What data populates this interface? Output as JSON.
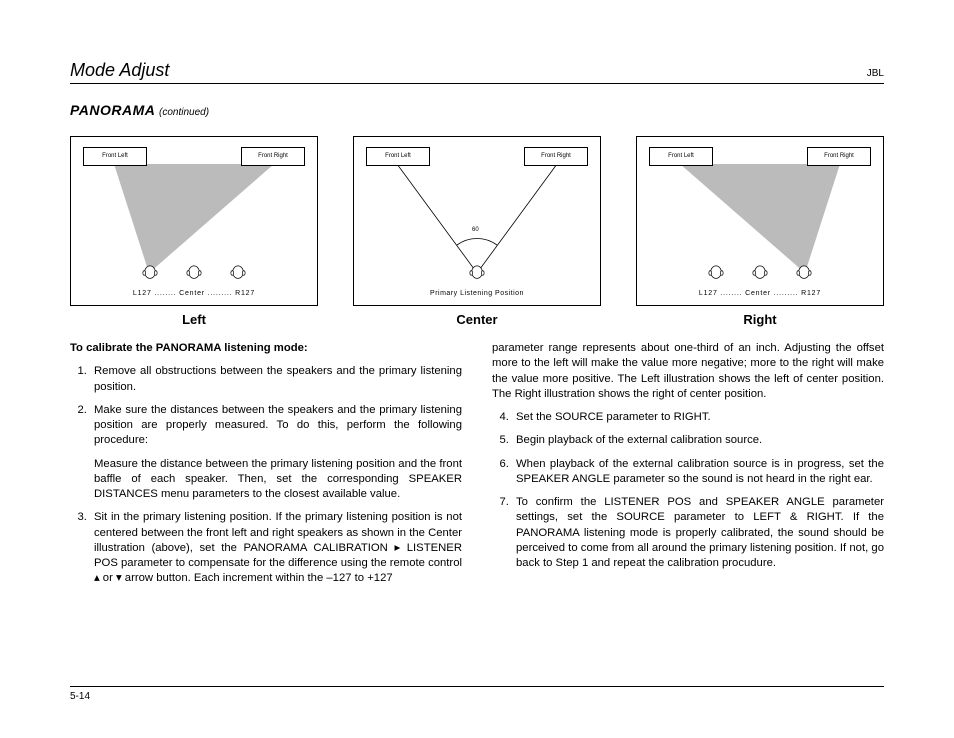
{
  "header": {
    "section": "Mode Adjust",
    "brand": "JBL"
  },
  "title": {
    "main": "PANORAMA",
    "cont": "(continued)"
  },
  "diagrams": {
    "speakerLeft": "Front Left",
    "speakerRight": "Front Right",
    "lcr": "L127 ........ Center ......... R127",
    "plp": "Primary Listening Position",
    "angle": "60",
    "captions": {
      "left": "Left",
      "center": "Center",
      "right": "Right"
    }
  },
  "body": {
    "lead": "To calibrate the PANORAMA listening mode:",
    "step1": "Remove all obstructions between the speakers and the primary listening position.",
    "step2": "Make sure the distances between the speakers and the primary listening position are properly measured. To do this, perform the following procedure:",
    "step2detail": "Measure the distance between the primary listening position and the front baffle of each speaker. Then, set the corresponding SPEAKER DISTANCES menu parameters to the closest available value.",
    "step3a": "Sit in the primary listening position. If the primary listening position is not centered between the front left and right speakers as shown in the Center illustration (above), set the PANORAMA CALIBRATION ",
    "step3b": " LISTENER POS parameter to compensate for the difference using the remote control ",
    "step3c": " or ",
    "step3d": " arrow button. Each increment within the –127 to +127",
    "rtop": "parameter range represents about one-third of an inch. Adjusting the offset more to the left will make the value more negative; more to the right will make the value more positive. The Left illustration shows the left of center position. The Right illustration shows the right of center position.",
    "step4": "Set the SOURCE parameter to RIGHT.",
    "step5": "Begin playback of the external calibration source.",
    "step6": "When playback of the external calibration source is in progress, set the SPEAKER ANGLE parameter so the sound is not heard in the right ear.",
    "step7": "To confirm the LISTENER POS and SPEAKER ANGLE parameter settings, set the SOURCE parameter to LEFT & RIGHT. If the PANORAMA listening mode is properly calibrated, the sound should be perceived to come from all around the primary listening position. If not, go back to Step 1 and repeat the calibration procudure."
  },
  "footer": {
    "page": "5-14"
  }
}
